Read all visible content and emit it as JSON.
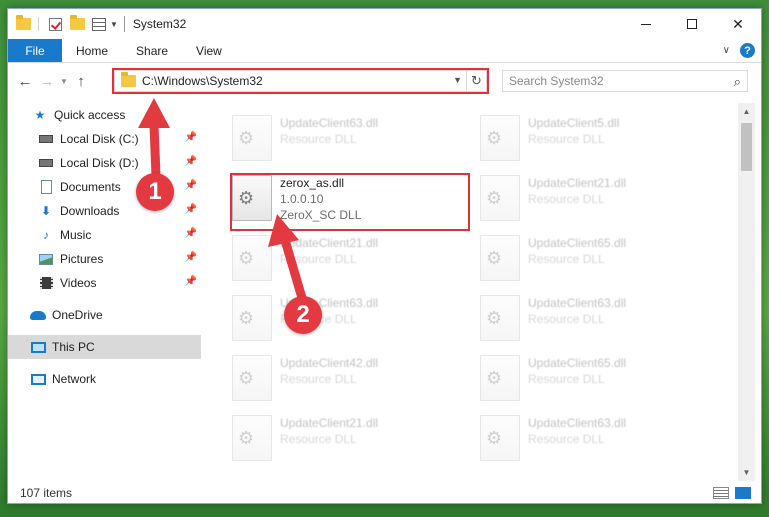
{
  "window": {
    "title": "System32"
  },
  "ribbon": {
    "tabs": [
      "File",
      "Home",
      "Share",
      "View"
    ],
    "help": "?"
  },
  "nav": {
    "address": "C:\\Windows\\System32",
    "search_placeholder": "Search System32"
  },
  "sidebar": {
    "items": [
      {
        "label": "Quick access",
        "icon": "star-icon",
        "pinned": false
      },
      {
        "label": "Local Disk (C:)",
        "icon": "disk-icon",
        "pinned": true
      },
      {
        "label": "Local Disk (D:)",
        "icon": "disk-icon",
        "pinned": true
      },
      {
        "label": "Documents",
        "icon": "document-icon",
        "pinned": true
      },
      {
        "label": "Downloads",
        "icon": "download-arrow-icon",
        "pinned": true
      },
      {
        "label": "Music",
        "icon": "music-note-icon",
        "pinned": true
      },
      {
        "label": "Pictures",
        "icon": "picture-icon",
        "pinned": true
      },
      {
        "label": "Videos",
        "icon": "film-icon",
        "pinned": true
      },
      {
        "label": "OneDrive",
        "icon": "cloud-icon",
        "pinned": false
      },
      {
        "label": "This PC",
        "icon": "computer-icon",
        "pinned": false,
        "selected": true
      },
      {
        "label": "Network",
        "icon": "network-icon",
        "pinned": false
      }
    ]
  },
  "files": {
    "highlighted": {
      "name": "zerox_as.dll",
      "version": "1.0.0.10",
      "description": "ZeroX_SC DLL"
    },
    "left_column": [
      {
        "name": "UpdateClient63.dll",
        "description": "Resource DLL"
      },
      {
        "name": "UpdateClient21.dll",
        "description": "Resource DLL"
      },
      {
        "name": "UpdateClient63.dll",
        "description": "Resource DLL"
      },
      {
        "name": "UpdateClient42.dll",
        "description": "Resource DLL"
      },
      {
        "name": "UpdateClient21.dll",
        "description": "Resource DLL"
      }
    ],
    "right_column": [
      {
        "name": "UpdateClient5.dll",
        "description": "Resource DLL"
      },
      {
        "name": "UpdateClient21.dll",
        "description": "Resource DLL"
      },
      {
        "name": "UpdateClient65.dll",
        "description": "Resource DLL"
      },
      {
        "name": "UpdateClient63.dll",
        "description": "Resource DLL"
      },
      {
        "name": "UpdateClient65.dll",
        "description": "Resource DLL"
      },
      {
        "name": "UpdateClient63.dll",
        "description": "Resource DLL"
      }
    ]
  },
  "status": {
    "item_count": "107 items"
  },
  "annotations": {
    "step1": "1",
    "step2": "2"
  },
  "colors": {
    "accent": "#1979ca",
    "highlight": "#e0303a"
  }
}
